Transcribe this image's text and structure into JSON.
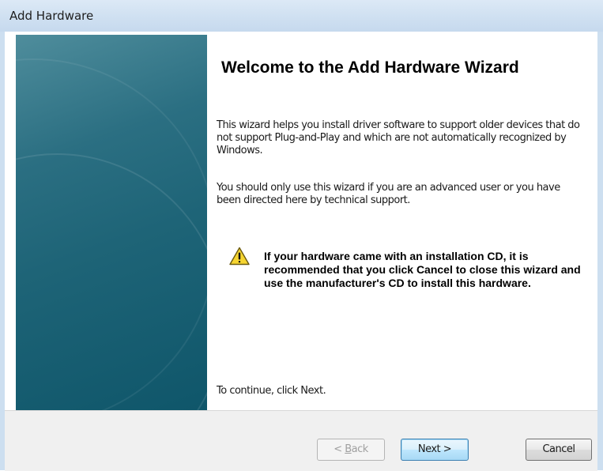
{
  "window": {
    "title": "Add Hardware"
  },
  "content": {
    "heading": "Welcome to the Add Hardware Wizard",
    "paragraph1": "This wizard helps you install driver software to support older devices that do not support Plug-and-Play and which are not automatically recognized by Windows.",
    "paragraph2": "You should only use this wizard if you are an advanced user or you have been directed here by technical support.",
    "warning": {
      "icon": "warning-triangle-icon",
      "text": "If your hardware came with an installation CD, it is recommended that you click Cancel to close this wizard and use the manufacturer's CD to install this hardware."
    },
    "continue_text": "To continue, click Next."
  },
  "buttons": {
    "back_prefix": "< ",
    "back_mnemonic": "B",
    "back_rest": "ack",
    "next_label": "Next >",
    "cancel_label": "Cancel",
    "back_enabled": false
  },
  "colors": {
    "side_panel": "#1e6477",
    "titlebar": "#cfe0f1",
    "warning_yellow": "#f6d531"
  }
}
